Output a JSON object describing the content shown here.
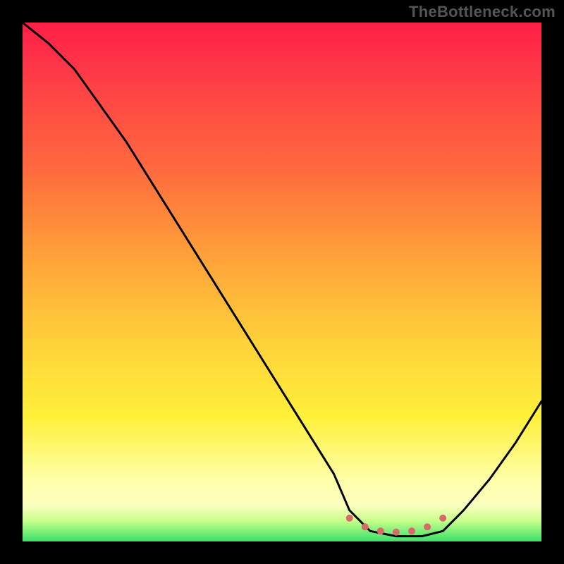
{
  "watermark": "TheBottleneck.com",
  "chart_data": {
    "type": "line",
    "title": "",
    "xlabel": "",
    "ylabel": "",
    "xlim": [
      0,
      100
    ],
    "ylim": [
      0,
      100
    ],
    "series": [
      {
        "name": "bottleneck-curve",
        "x": [
          0,
          5,
          10,
          15,
          20,
          25,
          30,
          35,
          40,
          45,
          50,
          55,
          60,
          63,
          67,
          72,
          77,
          81,
          85,
          90,
          95,
          100
        ],
        "y": [
          100,
          96,
          91,
          84,
          77,
          69,
          61,
          53,
          45,
          37,
          29,
          21,
          13,
          6,
          2,
          1,
          1,
          2,
          6,
          12,
          19,
          27
        ]
      }
    ],
    "annotations": [
      {
        "name": "basin-marker",
        "type": "dotted-segment",
        "x": [
          63,
          66,
          69,
          72,
          75,
          78,
          81
        ],
        "y": [
          4.5,
          2.8,
          2.0,
          1.8,
          2.0,
          2.8,
          4.5
        ],
        "color": "#d86a6a"
      }
    ],
    "colors": {
      "curve": "#000000",
      "marker": "#d86a6a",
      "gradient_top": "#ff1f47",
      "gradient_bottom": "#39e06a"
    }
  }
}
